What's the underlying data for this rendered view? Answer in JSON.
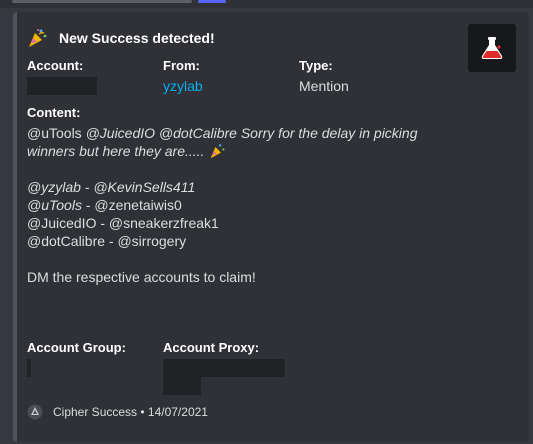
{
  "embed": {
    "author": {
      "icon": "party-popper-icon",
      "name": "New Success detected!"
    },
    "thumbnail": {
      "icon": "potion-flask-icon",
      "color": "#e02b2b"
    },
    "fields": {
      "account": {
        "label": "Account:"
      },
      "from": {
        "label": "From:",
        "value": "yzylab"
      },
      "type": {
        "label": "Type:",
        "value": "Mention"
      },
      "content": {
        "label": "Content:",
        "line1_a": "@uTools ",
        "line1_b": "@JuicedIO @dotCalibre Sorry for the delay in picking",
        "line2": "winners but here they are.....",
        "line4_a": "@yzylab",
        "line4_b": " - @KevinSells411",
        "line5_a": "@uTools",
        "line5_b": " - @zenetaiwis0",
        "line6": "@JuicedIO - @sneakerzfreak1",
        "line7": "@dotCalibre - @sirrogery",
        "line9": "DM the respective accounts to claim!"
      },
      "account_group": {
        "label": "Account Group:"
      },
      "account_proxy": {
        "label": "Account Proxy:"
      }
    },
    "footer": {
      "icon": "cipher-logo-icon",
      "text": "Cipher Success • 14/07/2021"
    },
    "accent_color": "#4f545c",
    "link_color": "#00aff4"
  }
}
